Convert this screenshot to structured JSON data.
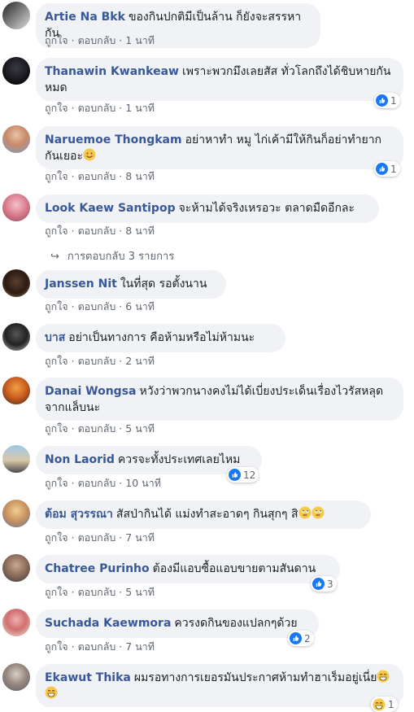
{
  "actions": {
    "like_label": "ถูกใจ",
    "reply_label": "ตอบกลับ",
    "separator": "·"
  },
  "replies_link": {
    "label": "การตอบกลับ 3 รายการ"
  },
  "comments": [
    {
      "author": "Artie Na Bkk",
      "text": "ของกินปกติมีเป็นล้าน ก็ยังจะสรรหากัน",
      "time": "1 นาที"
    },
    {
      "author": "Thanawin Kwankeaw",
      "text": "เพราะพวกมึงเลยสัส ทั่วโลกถึงได้ชิบหายกันหมด",
      "time": "1 นาที",
      "reaction_count": "1"
    },
    {
      "author": "Naruemoe Thongkam",
      "text": "อย่าหาทำ หมู ไก่เค้ามีให้กินก็อย่าทำยากกันเยอะ",
      "time": "8 นาที",
      "reaction_count": "1"
    },
    {
      "author": "Look Kaew Santipop",
      "text": "จะห้ามได้จริงเหรอวะ ตลาดมืดอีกละ",
      "time": "8 นาที"
    },
    {
      "author": "Janssen Nit",
      "text": "ในที่สุด รอตั้งนาน",
      "time": "6 นาที"
    },
    {
      "author": "บาส",
      "text": "อย่าเป็นทางการ คือห้ามหรือไม่ห้ามนะ",
      "time": "2 นาที"
    },
    {
      "author": "Danai Wongsa",
      "text": "หวังว่าพวกนางคงไม่ได้เบี่ยงประเด็นเรื่องไวรัสหลุดจากแล็บนะ",
      "time": "5 นาที"
    },
    {
      "author": "Non Laorid",
      "text": "ควรจะทั้งประเทศเลยไหม",
      "time": "10 นาที",
      "reaction_count": "12"
    },
    {
      "author": "ต้อม สุวรรณา",
      "text": "สัสป่ากินได้ แม่งทำสะอาดๆ กินสุกๆ สิ",
      "time": "7 นาที"
    },
    {
      "author": "Chatree Purinho",
      "text": "ต้องมีแอบซื้อแอบขายตามสันดาน",
      "time": "5 นาที",
      "reaction_count": "3"
    },
    {
      "author": "Suchada Kaewmora",
      "text": "ควรงดกินของแปลกๆด้วย",
      "time": "7 นาที",
      "reaction_count": "2"
    },
    {
      "author": "Ekawut Thika",
      "text": "ผมรอทางการเยอรมันประกาศห้ามทำฮาเร็มอยู่เนี่ย",
      "time": "",
      "reaction_count": "1"
    }
  ],
  "colors": {
    "author": "#385898",
    "bubble": "#f0f2f5",
    "meta": "#606770",
    "like": "#1877f2"
  },
  "icons": {
    "like": "thumbs-up-icon",
    "reply_arrow": "reply-arrow-icon",
    "smile": "smiling-emoji-icon",
    "rolling_eyes": "rolling-eyes-emoji-icon",
    "grin": "grinning-emoji-icon"
  }
}
